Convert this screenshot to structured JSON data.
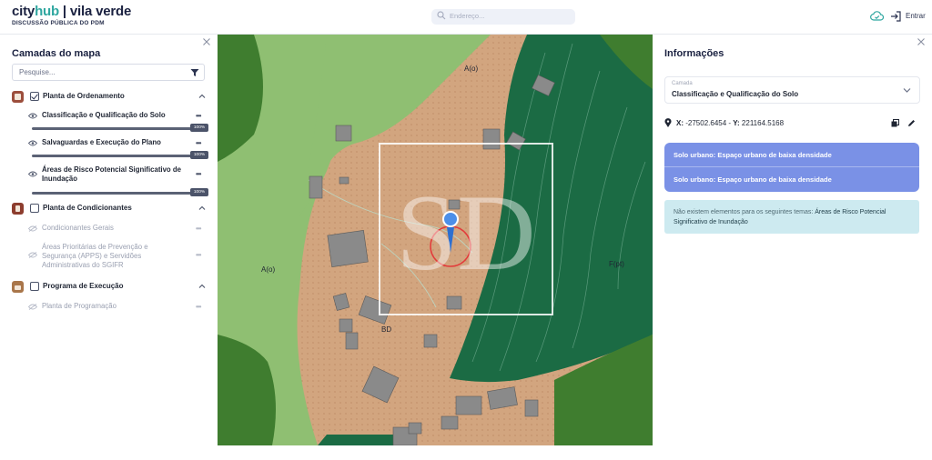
{
  "header": {
    "brand_city": "city",
    "brand_hub": "hub",
    "brand_sep": " | ",
    "brand_place": "vila verde",
    "subtitle": "DISCUSSÃO PÚBLICA DO PDM",
    "search_placeholder": "Endereço...",
    "login_label": "Entrar",
    "icons": [
      "search-icon",
      "cloud-check-icon",
      "login-icon"
    ]
  },
  "left_panel": {
    "title": "Camadas do mapa",
    "filter_placeholder": "Pesquise...",
    "groups": [
      {
        "label": "Planta de Ordenamento",
        "checked": true,
        "expanded": true,
        "layers": [
          {
            "label": "Classificação e Qualificação do Solo",
            "opacity": "100%",
            "visible": true
          },
          {
            "label": "Salvaguardas e Execução do Plano",
            "opacity": "100%",
            "visible": true
          },
          {
            "label": "Áreas de Risco Potencial Significativo de Inundação",
            "opacity": "100%",
            "visible": true
          }
        ]
      },
      {
        "label": "Planta de Condicionantes",
        "checked": false,
        "expanded": true,
        "layers": [
          {
            "label": "Condicionantes Gerais",
            "visible": false
          },
          {
            "label": "Áreas Prioritárias de Prevenção e Segurança (APPS) e Servidões Administrativas do SGIFR",
            "visible": false
          }
        ]
      },
      {
        "label": "Programa de Execução",
        "checked": false,
        "expanded": true,
        "layers": [
          {
            "label": "Planta de Programação",
            "visible": false
          }
        ]
      }
    ]
  },
  "map": {
    "labels": [
      "A(o)",
      "A(o)",
      "F(pt)",
      "BD"
    ],
    "colors": {
      "urban": "#d2a57f",
      "agri_light": "#8fbf72",
      "forest_dark": "#1b6b44",
      "forest_mid": "#3f7d2f",
      "building": "#8a8a8a"
    }
  },
  "right_panel": {
    "title": "Informações",
    "select_caption": "Camada",
    "select_value": "Classificação e Qualificação do Solo",
    "coord_x_label": "X:",
    "coord_x": "-27502.6454",
    "coord_sep": " - ",
    "coord_y_label": "Y:",
    "coord_y": "221164.5168",
    "results": [
      "Solo urbano: Espaço urbano de baixa densidade",
      "Solo urbano: Espaço urbano de baixa densidade"
    ],
    "note_prefix": "Não existem elementos para os seguintes temas: ",
    "note_highlight": "Áreas de Risco Potencial Significativo de Inundação",
    "accent": "#7a91e6",
    "note_bg": "#cdeaf0"
  }
}
